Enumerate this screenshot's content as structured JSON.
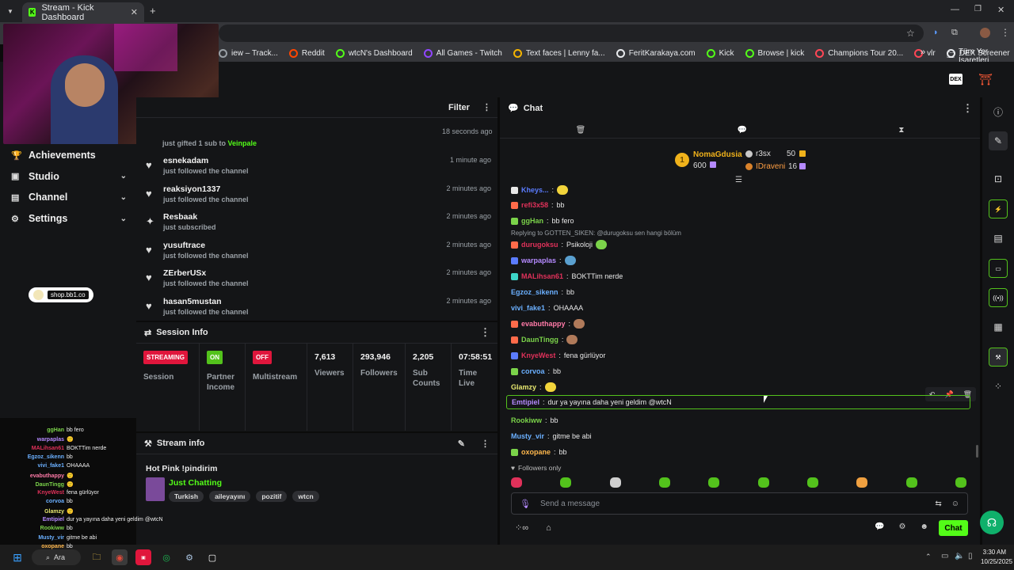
{
  "browser": {
    "tab_title": "Stream - Kick Dashboard",
    "bookmarks": [
      {
        "label": "iew – Track...",
        "color": "#9aa0a6"
      },
      {
        "label": "Reddit",
        "color": "#ff4500"
      },
      {
        "label": "wtcN's Dashboard",
        "color": "#53fc18"
      },
      {
        "label": "All Games - Twitch",
        "color": "#9146ff"
      },
      {
        "label": "Text faces | Lenny fa...",
        "color": "#f4b400"
      },
      {
        "label": "FeritKarakaya.com",
        "color": "#e8eaed"
      },
      {
        "label": "Kick",
        "color": "#53fc18"
      },
      {
        "label": "Browse | kick",
        "color": "#53fc18"
      },
      {
        "label": "Champions Tour 20...",
        "color": "#ff4655"
      },
      {
        "label": "vlr",
        "color": "#ff4655"
      },
      {
        "label": "DEX Screener",
        "color": "#e8eaed"
      }
    ],
    "bookmarks_more": "»",
    "all_bookmarks": "Tüm Yer İşaretleri"
  },
  "nav": {
    "items": [
      {
        "label": "Achievements",
        "icon": "trophy-icon",
        "glyph": "🏆",
        "chevron": false
      },
      {
        "label": "Studio",
        "icon": "studio-icon",
        "glyph": "▣",
        "chevron": true
      },
      {
        "label": "Channel",
        "icon": "channel-icon",
        "glyph": "▤",
        "chevron": true
      },
      {
        "label": "Settings",
        "icon": "gear-icon",
        "glyph": "⚙",
        "chevron": true
      }
    ],
    "shop_label": "shop.bb1.co"
  },
  "activity": {
    "filter_label": "Filter",
    "first_time": "18 seconds ago",
    "first_sub": "just gifted 1 sub to",
    "first_target": "Veinpale",
    "rows": [
      {
        "name": "esnekadam",
        "sub": "just followed the channel",
        "time": "1 minute ago",
        "glyph": "♥"
      },
      {
        "name": "reaksiyon1337",
        "sub": "just followed the channel",
        "time": "2 minutes ago",
        "glyph": "♥"
      },
      {
        "name": "Resbaak",
        "sub": "just subscribed",
        "time": "2 minutes ago",
        "glyph": "✦"
      },
      {
        "name": "yusuftrace",
        "sub": "just followed the channel",
        "time": "2 minutes ago",
        "glyph": "♥"
      },
      {
        "name": "ZErberUSx",
        "sub": "just followed the channel",
        "time": "2 minutes ago",
        "glyph": "♥"
      },
      {
        "name": "hasan5mustan",
        "sub": "just followed the channel",
        "time": "2 minutes ago",
        "glyph": "♥"
      }
    ]
  },
  "session": {
    "title": "Session Info",
    "cols": [
      {
        "badge": "STREAMING",
        "badge_color": "#e0163c",
        "label": "Session"
      },
      {
        "badge": "ON",
        "badge_color": "#53c21c",
        "label": "Partner Income"
      },
      {
        "badge": "OFF",
        "badge_color": "#e0163c",
        "label": "Multistream"
      },
      {
        "value": "7,613",
        "label": "Viewers"
      },
      {
        "value": "293,946",
        "label": "Followers"
      },
      {
        "value": "2,205",
        "label": "Sub Counts"
      },
      {
        "value": "07:58:51",
        "label": "Time Live"
      }
    ]
  },
  "stream_info": {
    "header": "Stream info",
    "title": "Hot Pink !pindirim",
    "category": "Just Chatting",
    "tags": [
      "Turkish",
      "aileyayını",
      "pozitif",
      "wtcn"
    ]
  },
  "chat": {
    "header": "Chat",
    "leaderboard": {
      "rank": "1",
      "top_name": "NomaGdusia",
      "top_value": "600",
      "second_name": "r3sx",
      "second_value": "50",
      "third_name": "IDraveni",
      "third_value": "16"
    },
    "messages": [
      {
        "user": "Kheys...",
        "color": "#5b7cff",
        "text": "",
        "emote": true,
        "badge": "#e8e8e8"
      },
      {
        "user": "refi3x58",
        "color": "#e0315a",
        "text": "bb",
        "emote": false,
        "badge": "#ff6b4a"
      },
      {
        "user": "ggHan",
        "color": "#7bd34a",
        "text": "bb fero",
        "emote": false,
        "badge": "#7bd34a"
      },
      {
        "user": "durugoksu",
        "color": "#e0315a",
        "text": "Psikoloji",
        "emote": true,
        "badge": "#ff6b4a",
        "reply": "Replying to GOTTEN_SIKEN: @durugoksu sen hangi bölüm"
      },
      {
        "user": "warpaplas",
        "color": "#b58aff",
        "text": "",
        "emote": true,
        "badge": "#5b7cff"
      },
      {
        "user": "MALihsan61",
        "color": "#e0315a",
        "text": "BOKTTim nerde",
        "emote": false,
        "badge": "#3dd6c8"
      },
      {
        "user": "Egzoz_sikenn",
        "color": "#6bb0ff",
        "text": "bb",
        "emote": false,
        "badge": ""
      },
      {
        "user": "vivi_fake1",
        "color": "#6bb0ff",
        "text": "OHAAAA",
        "emote": false,
        "badge": ""
      },
      {
        "user": "evabuthappy",
        "color": "#ff7aa8",
        "text": "",
        "emote": true,
        "badge": "#ff6b4a"
      },
      {
        "user": "DaunTingg",
        "color": "#7bd34a",
        "text": "",
        "emote": true,
        "badge": "#ff6b4a"
      },
      {
        "user": "KnyeWest",
        "color": "#e0315a",
        "text": "fena gürlüyor",
        "emote": false,
        "badge": "#5b7cff"
      },
      {
        "user": "corvoa",
        "color": "#6bb0ff",
        "text": "bb",
        "emote": false,
        "badge": "#7bd34a"
      },
      {
        "user": "Glamzy",
        "color": "#e8e870",
        "text": "",
        "emote": true,
        "badge": ""
      },
      {
        "user": "Emtipiel",
        "color": "#b58aff",
        "text": "dur ya yayına daha yeni geldim @wtcN",
        "emote": false,
        "badge": "",
        "highlight": true
      },
      {
        "user": "Rookiww",
        "color": "#7bd34a",
        "text": "bb",
        "emote": false,
        "badge": ""
      },
      {
        "user": "Musty_vir",
        "color": "#6bb0ff",
        "text": "gitme be abi",
        "emote": false,
        "badge": ""
      },
      {
        "user": "oxopane",
        "color": "#ffb84d",
        "text": "bb",
        "emote": false,
        "badge": "#7bd34a"
      }
    ],
    "followers_only": "Followers only",
    "placeholder": "Send a message",
    "send_label": "Chat"
  },
  "overlay": [
    {
      "user": "ggHan",
      "color": "#7bd34a",
      "text": "bb fero"
    },
    {
      "user": "warpaplas",
      "color": "#b58aff",
      "text": "🙂"
    },
    {
      "user": "MALihsan61",
      "color": "#e0315a",
      "text": "BOKTTim nerde"
    },
    {
      "user": "Egzoz_sikenn",
      "color": "#6bb0ff",
      "text": "bb"
    },
    {
      "user": "vivi_fake1",
      "color": "#6bb0ff",
      "text": "OHAAAA"
    },
    {
      "user": "evabuthappy",
      "color": "#ff7aa8",
      "text": "🙂"
    },
    {
      "user": "DaunTingg",
      "color": "#7bd34a",
      "text": "🙂"
    },
    {
      "user": "KnyeWest",
      "color": "#e0315a",
      "text": "fena gürlüyor"
    },
    {
      "user": "corvoa",
      "color": "#6bb0ff",
      "text": "bb"
    },
    {
      "user": "Glamzy",
      "color": "#e8e870",
      "text": "🙂"
    },
    {
      "user": "Emtipiel",
      "color": "#b58aff",
      "text": "dur ya yayına daha yeni geldim @wtcN"
    },
    {
      "user": "Rookiww",
      "color": "#7bd34a",
      "text": "bb"
    },
    {
      "user": "Musty_vir",
      "color": "#6bb0ff",
      "text": "gitme be abi"
    },
    {
      "user": "oxopane",
      "color": "#ffb84d",
      "text": "bb"
    }
  ],
  "taskbar": {
    "search": "Ara",
    "time": "3:30 AM",
    "date": "10/25/2025"
  }
}
